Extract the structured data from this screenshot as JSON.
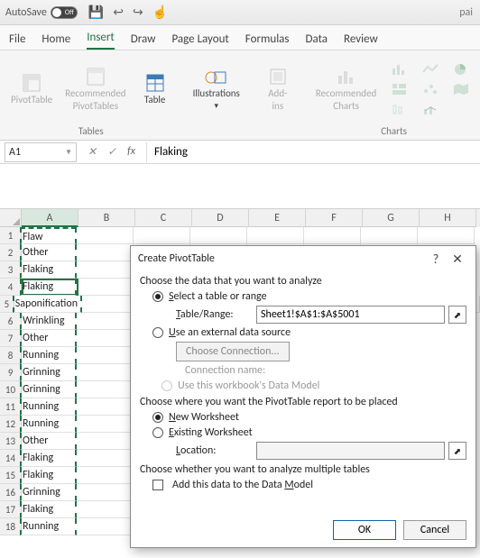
{
  "titlebar": {
    "autosave_label": "AutoSave",
    "toggle_state": "Off",
    "doc_partial": "pai"
  },
  "tabs": [
    "File",
    "Home",
    "Insert",
    "Draw",
    "Page Layout",
    "Formulas",
    "Data",
    "Review"
  ],
  "active_tab": "Insert",
  "ribbon": {
    "tables": {
      "pivot": "PivotTable",
      "recpivot_l1": "Recommended",
      "recpivot_l2": "PivotTables",
      "table": "Table",
      "label": "Tables"
    },
    "illus": {
      "btn_l1": "Illustrations",
      "label": ""
    },
    "addins": {
      "btn_l1": "Add-",
      "btn_l2": "ins"
    },
    "charts": {
      "rec_l1": "Recommended",
      "rec_l2": "Charts",
      "label": "Charts"
    }
  },
  "namebox": "A1",
  "formula_value": "Flaking",
  "columns": [
    "A",
    "B",
    "C",
    "D",
    "E",
    "F",
    "G",
    "H"
  ],
  "rows": [
    {
      "n": 1,
      "v": "Flaw"
    },
    {
      "n": 2,
      "v": "Other"
    },
    {
      "n": 3,
      "v": "Flaking"
    },
    {
      "n": 4,
      "v": "Flaking"
    },
    {
      "n": 5,
      "v": "Saponification"
    },
    {
      "n": 6,
      "v": "Wrinkling"
    },
    {
      "n": 7,
      "v": "Other"
    },
    {
      "n": 8,
      "v": "Running"
    },
    {
      "n": 9,
      "v": "Grinning"
    },
    {
      "n": 10,
      "v": "Grinning"
    },
    {
      "n": 11,
      "v": "Running"
    },
    {
      "n": 12,
      "v": "Running"
    },
    {
      "n": 13,
      "v": "Other"
    },
    {
      "n": 14,
      "v": "Flaking"
    },
    {
      "n": 15,
      "v": "Flaking"
    },
    {
      "n": 16,
      "v": "Grinning"
    },
    {
      "n": 17,
      "v": "Flaking"
    },
    {
      "n": 18,
      "v": "Running"
    }
  ],
  "dialog": {
    "title": "Create PivotTable",
    "analyze": "Choose the data that you want to analyze",
    "opt_range": "Select a table or range",
    "table_range_label": "Table/Range:",
    "table_range_value": "Sheet1!$A$1:$A$5001",
    "opt_external": "Use an external data source",
    "choose_conn": "Choose Connection...",
    "conn_name": "Connection name:",
    "use_model": "Use this workbook's Data Model",
    "place": "Choose where you want the PivotTable report to be placed",
    "opt_newws": "New Worksheet",
    "opt_existws": "Existing Worksheet",
    "location_label": "Location:",
    "location_value": "",
    "multi": "Choose whether you want to analyze multiple tables",
    "add_model": "Add this data to the Data Model",
    "ok": "OK",
    "cancel": "Cancel"
  }
}
